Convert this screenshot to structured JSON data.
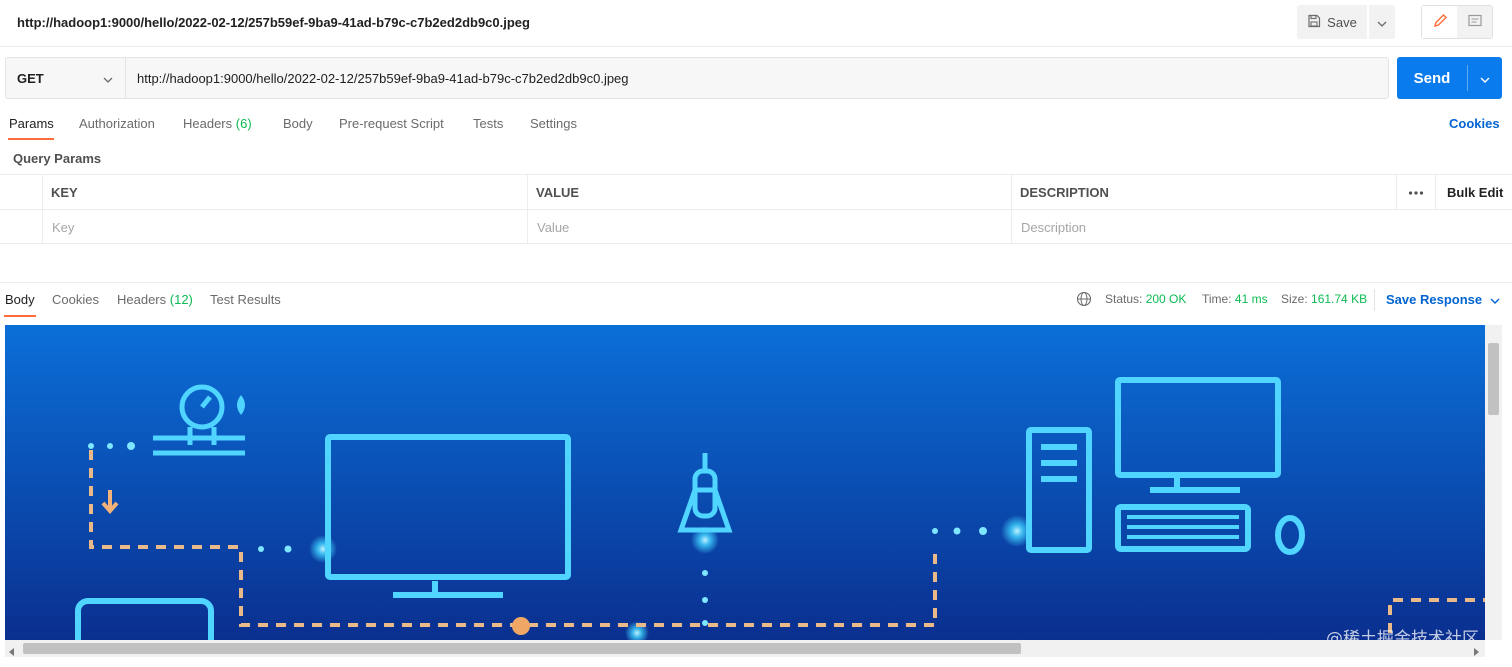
{
  "request": {
    "title": "http://hadoop1:9000/hello/2022-02-12/257b59ef-9ba9-41ad-b79c-c7b2ed2db9c0.jpeg",
    "method": "GET",
    "url": "http://hadoop1:9000/hello/2022-02-12/257b59ef-9ba9-41ad-b79c-c7b2ed2db9c0.jpeg"
  },
  "toolbar": {
    "save_label": "Save",
    "send_label": "Send"
  },
  "request_tabs": {
    "params": "Params",
    "authorization": "Authorization",
    "headers": "Headers",
    "headers_count": "(6)",
    "body": "Body",
    "pre_request": "Pre-request Script",
    "tests": "Tests",
    "settings": "Settings",
    "cookies": "Cookies"
  },
  "query_params": {
    "title": "Query Params",
    "columns": {
      "key": "KEY",
      "value": "VALUE",
      "description": "DESCRIPTION"
    },
    "bulk_edit": "Bulk Edit",
    "placeholders": {
      "key": "Key",
      "value": "Value",
      "description": "Description"
    }
  },
  "response": {
    "tabs": {
      "body": "Body",
      "cookies": "Cookies",
      "headers": "Headers",
      "headers_count": "(12)",
      "test_results": "Test Results"
    },
    "status_label": "Status:",
    "status_value": "200 OK",
    "time_label": "Time:",
    "time_value": "41 ms",
    "size_label": "Size:",
    "size_value": "161.74 KB",
    "save_response": "Save Response"
  },
  "watermark": "@稀土掘金技术社区",
  "colors": {
    "accent": "#097bed",
    "tab_active": "#ff6c37",
    "success": "#0cbb52",
    "link": "#0265d2",
    "image_bg": "#0a4fb3",
    "image_glow": "#3fd0ff"
  },
  "icons": [
    "save-icon",
    "chevron-down-icon",
    "pencil-icon",
    "comment-icon",
    "globe-icon",
    "more-dots-icon"
  ]
}
